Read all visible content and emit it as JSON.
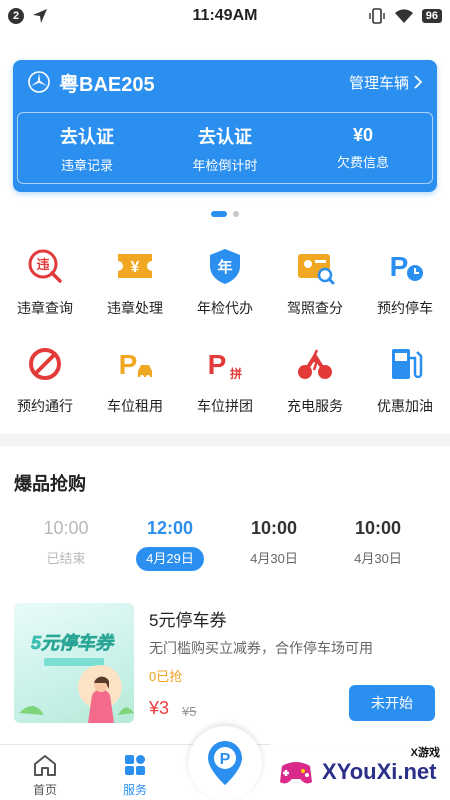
{
  "status_bar": {
    "notification_count": "2",
    "time": "11:49AM",
    "battery": "96"
  },
  "vehicle": {
    "plate": "粤BAE205",
    "manage_label": "管理车辆",
    "stats": [
      {
        "value": "去认证",
        "label": "违章记录"
      },
      {
        "value": "去认证",
        "label": "年检倒计时"
      },
      {
        "value": "¥0",
        "label": "欠费信息"
      }
    ]
  },
  "services": {
    "row1": [
      {
        "label": "违章查询",
        "icon": "violation-search-icon"
      },
      {
        "label": "违章处理",
        "icon": "violation-ticket-icon"
      },
      {
        "label": "年检代办",
        "icon": "annual-inspection-shield-icon"
      },
      {
        "label": "驾照查分",
        "icon": "license-points-icon"
      },
      {
        "label": "预约停车",
        "icon": "parking-clock-icon"
      }
    ],
    "row2": [
      {
        "label": "预约通行",
        "icon": "no-entry-icon"
      },
      {
        "label": "车位租用",
        "icon": "parking-rent-icon"
      },
      {
        "label": "车位拼团",
        "icon": "parking-group-icon"
      },
      {
        "label": "充电服务",
        "icon": "charging-icon"
      },
      {
        "label": "优惠加油",
        "icon": "fuel-pump-icon"
      }
    ],
    "icon_text": {
      "violation": "违",
      "ticket": "¥",
      "inspection": "年",
      "parking": "P",
      "group": "拼"
    }
  },
  "flash_sale": {
    "title": "爆品抢购",
    "slots": [
      {
        "time": "10:00",
        "label": "已结束",
        "state": "ended"
      },
      {
        "time": "12:00",
        "label": "4月29日",
        "state": "active"
      },
      {
        "time": "10:00",
        "label": "4月30日",
        "state": "upcoming"
      },
      {
        "time": "10:00",
        "label": "4月30日",
        "state": "upcoming"
      }
    ]
  },
  "product": {
    "image_text": "5元停车券",
    "title": "5元停车券",
    "description": "无门槛购买立减券，合作停车场可用",
    "sold": "0已抢",
    "price": "¥3",
    "original_price": "¥5",
    "button": "未开始"
  },
  "tabbar": {
    "tabs": [
      {
        "label": "首页",
        "icon": "home-icon"
      },
      {
        "label": "服务",
        "icon": "services-grid-icon"
      }
    ],
    "center_label": "P"
  },
  "watermark": {
    "text": "XYouXi.net",
    "sub": "X游戏"
  },
  "colors": {
    "primary": "#2b8ff0",
    "price_red": "#f03c3c",
    "sold_orange": "#f0a020",
    "icon_red": "#e33a3a",
    "icon_orange": "#f0a822"
  }
}
